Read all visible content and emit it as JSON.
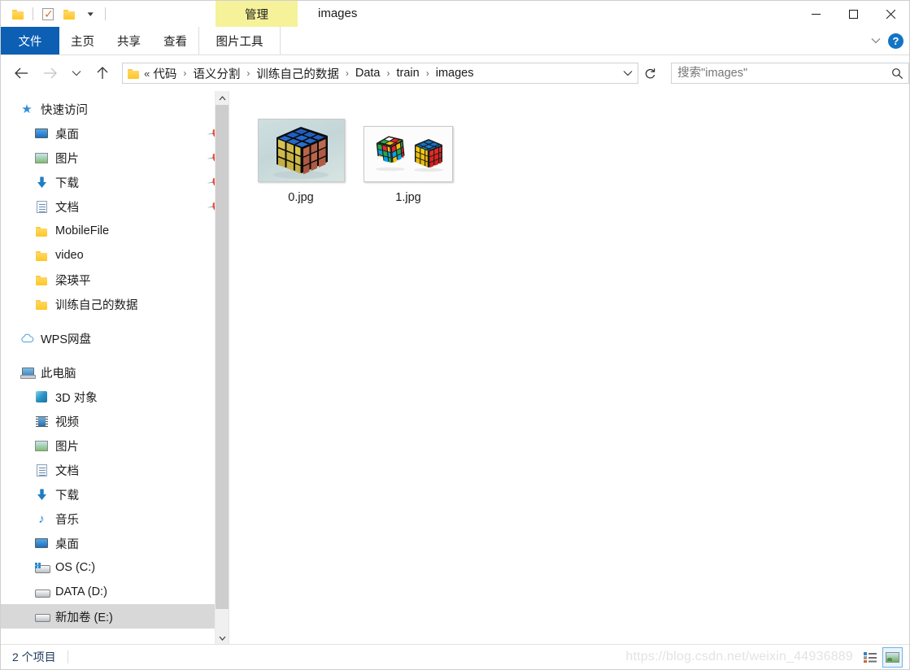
{
  "window": {
    "title": "images",
    "contextual_tab_group": "管理",
    "minimize_label": "—",
    "maximize_label": "□",
    "close_label": "✕"
  },
  "quick_access_toolbar": {
    "items": [
      {
        "name": "folder-icon",
        "label": "属性"
      },
      {
        "name": "properties-icon",
        "label": "属性"
      },
      {
        "name": "new-folder-icon",
        "label": "新建文件夹"
      },
      {
        "name": "customize-caret",
        "label": "自定义快速访问工具栏"
      }
    ]
  },
  "ribbon": {
    "tabs": [
      {
        "id": "file",
        "label": "文件",
        "state": "file"
      },
      {
        "id": "home",
        "label": "主页",
        "state": "normal"
      },
      {
        "id": "share",
        "label": "共享",
        "state": "normal"
      },
      {
        "id": "view",
        "label": "查看",
        "state": "normal"
      },
      {
        "id": "picture-tools",
        "label": "图片工具",
        "state": "active"
      }
    ],
    "collapse_label": "∨",
    "help_label": "?"
  },
  "address": {
    "back_label": "←",
    "forward_label": "→",
    "recent_label": "∨",
    "up_label": "↑",
    "overflow_label": "«",
    "crumbs": [
      "代码",
      "语义分割",
      "训练自己的数据",
      "Data",
      "train",
      "images"
    ],
    "separator": "›",
    "dropdown_label": "∨",
    "refresh_label": "↻"
  },
  "search": {
    "placeholder": "搜索\"images\"",
    "value": "",
    "icon_label": "⌕"
  },
  "sidebar": {
    "scroll_up_label": "⌃",
    "scroll_down_label": "⌄",
    "groups": [
      {
        "id": "quick-access",
        "header": {
          "label": "快速访问",
          "icon": "star-icon"
        },
        "items": [
          {
            "label": "桌面",
            "icon": "desktop-icon",
            "pinned": true
          },
          {
            "label": "图片",
            "icon": "pictures-icon",
            "pinned": true
          },
          {
            "label": "下载",
            "icon": "download-icon",
            "pinned": true
          },
          {
            "label": "文档",
            "icon": "documents-icon",
            "pinned": true
          },
          {
            "label": "MobileFile",
            "icon": "folder-icon",
            "pinned": false
          },
          {
            "label": "video",
            "icon": "folder-icon",
            "pinned": false
          },
          {
            "label": "梁瑛平",
            "icon": "folder-icon",
            "pinned": false
          },
          {
            "label": "训练自己的数据",
            "icon": "folder-icon",
            "pinned": false
          }
        ]
      },
      {
        "id": "wps-cloud",
        "header": {
          "label": "WPS网盘",
          "icon": "cloud-icon"
        },
        "items": []
      },
      {
        "id": "this-pc",
        "header": {
          "label": "此电脑",
          "icon": "this-pc-icon"
        },
        "items": [
          {
            "label": "3D 对象",
            "icon": "3d-objects-icon",
            "pinned": false
          },
          {
            "label": "视频",
            "icon": "videos-icon",
            "pinned": false
          },
          {
            "label": "图片",
            "icon": "pictures-icon",
            "pinned": false
          },
          {
            "label": "文档",
            "icon": "documents-icon",
            "pinned": false
          },
          {
            "label": "下载",
            "icon": "download-icon",
            "pinned": false
          },
          {
            "label": "音乐",
            "icon": "music-icon",
            "pinned": false
          },
          {
            "label": "桌面",
            "icon": "desktop-icon",
            "pinned": false
          },
          {
            "label": "OS (C:)",
            "icon": "system-drive-icon",
            "pinned": false
          },
          {
            "label": "DATA (D:)",
            "icon": "drive-icon",
            "pinned": false
          },
          {
            "label": "新加卷 (E:)",
            "icon": "drive-icon",
            "pinned": false,
            "selected": true
          }
        ]
      }
    ]
  },
  "files": [
    {
      "name": "0.jpg",
      "thumbnail": "rubiks-cube-single"
    },
    {
      "name": "1.jpg",
      "thumbnail": "rubiks-cube-pair"
    }
  ],
  "status": {
    "item_count_text": "2 个项目",
    "watermark": "https://blog.csdn.net/weixin_44936889",
    "view_buttons": [
      {
        "id": "details-view",
        "label": "详细信息",
        "active": false
      },
      {
        "id": "large-icons-view",
        "label": "大图标",
        "active": true
      }
    ]
  },
  "colors": {
    "accent_blue": "#0c5fb3",
    "contextual_yellow": "#f5f29a",
    "selection_gray": "#d8d8d8",
    "status_text": "#1b3a5c",
    "watermark": "#e3e3e3"
  }
}
